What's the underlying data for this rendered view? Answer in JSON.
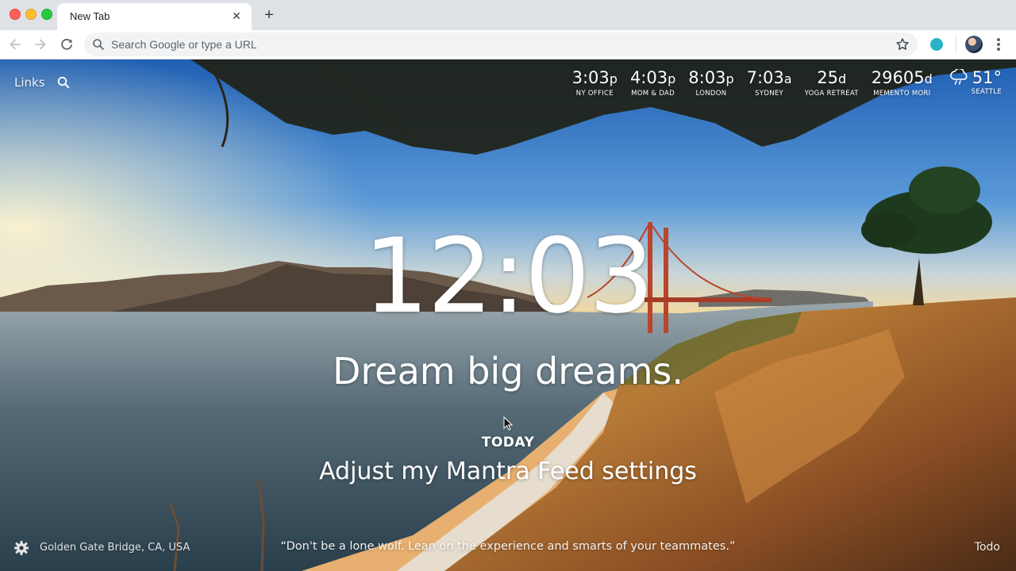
{
  "browser": {
    "tab_title": "New Tab",
    "tab_close_icon": "close-icon",
    "new_tab_icon": "plus-icon",
    "omnibox_placeholder": "Search Google or type a URL",
    "extension_color": "#29b3c5"
  },
  "momentum": {
    "links_label": "Links",
    "world_clocks": [
      {
        "value": "3:03",
        "suffix": "p",
        "label": "NY OFFICE"
      },
      {
        "value": "4:03",
        "suffix": "p",
        "label": "MOM & DAD"
      },
      {
        "value": "8:03",
        "suffix": "p",
        "label": "LONDON"
      },
      {
        "value": "7:03",
        "suffix": "a",
        "label": "SYDNEY"
      },
      {
        "value": "25",
        "suffix": "d",
        "label": "YOGA RETREAT"
      },
      {
        "value": "29605",
        "suffix": "d",
        "label": "MEMENTO MORI"
      }
    ],
    "weather": {
      "temp": "51°",
      "location": "SEATTLE",
      "icon": "cloud-rain-icon"
    },
    "time": "12:03",
    "mantra": "Dream big dreams.",
    "focus_label": "TODAY",
    "focus_text": "Adjust my Mantra Feed settings",
    "photo_location": "Golden Gate Bridge, CA, USA",
    "quote": "“Don't be a lone wolf. Lean on the experience and smarts of your teammates.”",
    "todo_label": "Todo"
  }
}
